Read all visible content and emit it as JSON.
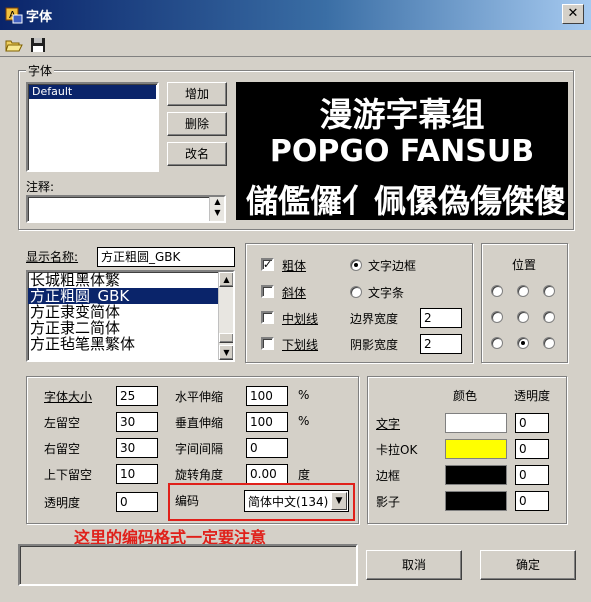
{
  "window": {
    "title": "字体",
    "close_glyph": "✕"
  },
  "toolbar": {
    "open_icon": "folder-open-icon",
    "save_icon": "floppy-disk-icon"
  },
  "font_group": {
    "label": "字体",
    "list_items": [
      "Default"
    ],
    "add_label": "增加",
    "delete_label": "删除",
    "rename_label": "改名",
    "comment_label": "注释:",
    "comment_value": ""
  },
  "preview": {
    "line1": "漫游字幕组",
    "line2": "POPGO FANSUB",
    "line3": "儲儖儸亻佩傫偽傷傑傻"
  },
  "display": {
    "name_label": "显示名称:",
    "name_value": "方正粗圆_GBK",
    "font_list": [
      "长城粗黑体繁",
      "方正粗圆_GBK",
      "方正隶变简体",
      "方正隶二简体",
      "方正毡笔黑繁体"
    ],
    "selected_index": 1
  },
  "style": {
    "bold_label": "粗体",
    "bold_checked": true,
    "italic_label": "斜体",
    "italic_checked": false,
    "strike_label": "中划线",
    "strike_checked": false,
    "underline_label": "下划线",
    "underline_checked": false,
    "border_radio_label": "文字边框",
    "border_radio_selected": true,
    "bar_radio_label": "文字条",
    "bar_radio_selected": false,
    "border_width_label": "边界宽度",
    "border_width_value": "2",
    "shadow_width_label": "阴影宽度",
    "shadow_width_value": "2"
  },
  "position": {
    "label": "位置",
    "selected": "bottom-center"
  },
  "params": {
    "size_label": "字体大小",
    "size_value": "25",
    "left_margin_label": "左留空",
    "left_margin_value": "30",
    "right_margin_label": "右留空",
    "right_margin_value": "30",
    "vmargin_label": "上下留空",
    "vmargin_value": "10",
    "opacity_label": "透明度",
    "opacity_value": "0",
    "hscale_label": "水平伸缩",
    "hscale_value": "100",
    "hscale_unit": "%",
    "vscale_label": "垂直伸缩",
    "vscale_value": "100",
    "vscale_unit": "%",
    "spacing_label": "字间间隔",
    "spacing_value": "0",
    "rotation_label": "旋转角度",
    "rotation_value": "0.00",
    "rotation_unit": "度",
    "encoding_label": "编码",
    "encoding_value": "简体中文(134)"
  },
  "colors": {
    "color_header": "颜色",
    "alpha_header": "透明度",
    "rows": [
      {
        "label": "文字",
        "color": "#ffffff",
        "alpha": "0"
      },
      {
        "label": "卡拉OK",
        "color": "#ffff00",
        "alpha": "0"
      },
      {
        "label": "边框",
        "color": "#000000",
        "alpha": "0"
      },
      {
        "label": "影子",
        "color": "#000000",
        "alpha": "0"
      }
    ]
  },
  "annotation": {
    "text": "这里的编码格式一定要注意",
    "color": "#e0201a"
  },
  "buttons": {
    "cancel_label": "取消",
    "ok_label": "确定"
  }
}
